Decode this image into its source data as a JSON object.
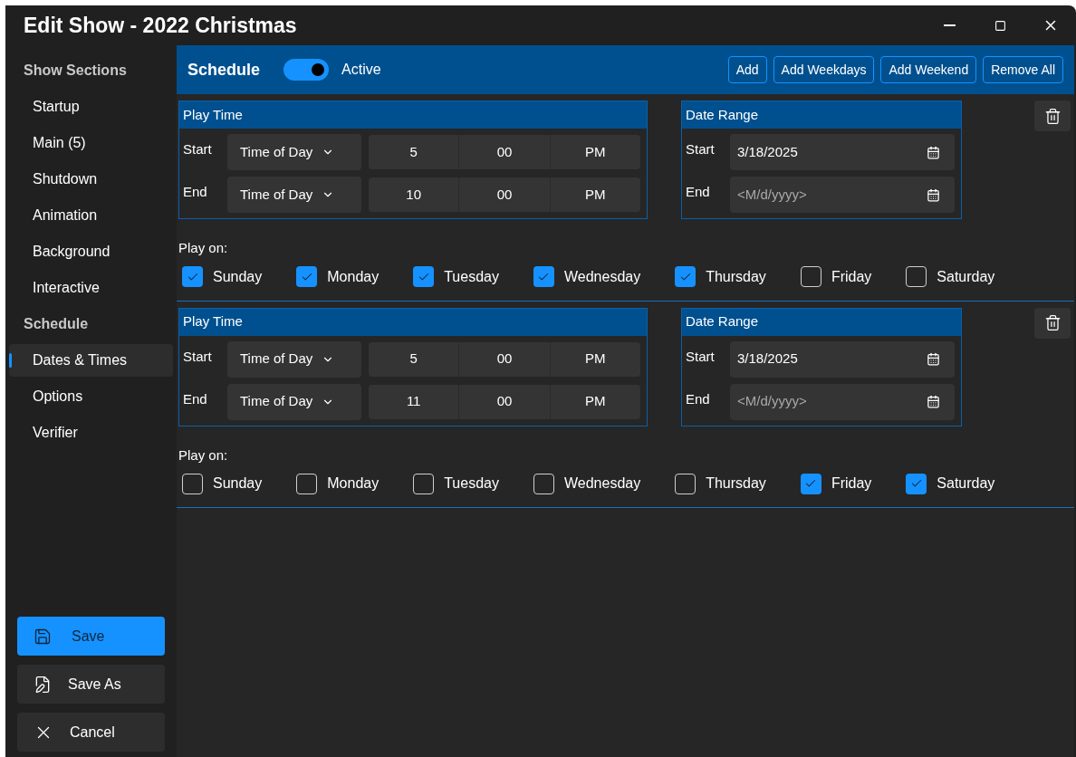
{
  "window": {
    "title": "Edit Show - 2022 Christmas"
  },
  "sidebar": {
    "groups": [
      {
        "heading": "Show Sections",
        "items": [
          {
            "label": "Startup",
            "selected": false
          },
          {
            "label": "Main (5)",
            "selected": false
          },
          {
            "label": "Shutdown",
            "selected": false
          },
          {
            "label": "Animation",
            "selected": false
          },
          {
            "label": "Background",
            "selected": false
          },
          {
            "label": "Interactive",
            "selected": false
          }
        ]
      },
      {
        "heading": "Schedule",
        "items": [
          {
            "label": "Dates & Times",
            "selected": true
          },
          {
            "label": "Options",
            "selected": false
          },
          {
            "label": "Verifier",
            "selected": false
          }
        ]
      }
    ],
    "buttons": [
      {
        "label": "Save",
        "kind": "save",
        "primary": true
      },
      {
        "label": "Save As",
        "kind": "save-as",
        "primary": false
      },
      {
        "label": "Cancel",
        "kind": "cancel",
        "primary": false
      }
    ]
  },
  "header": {
    "title": "Schedule",
    "active": {
      "label": "Active",
      "on": true
    },
    "buttons": [
      "Add",
      "Add Weekdays",
      "Add Weekend",
      "Remove All"
    ]
  },
  "schedules": [
    {
      "play_time": {
        "title": "Play Time",
        "rows": [
          {
            "label": "Start",
            "mode": "Time of Day",
            "hour": "5",
            "minute": "00",
            "period": "PM"
          },
          {
            "label": "End",
            "mode": "Time of Day",
            "hour": "10",
            "minute": "00",
            "period": "PM"
          }
        ]
      },
      "date_range": {
        "title": "Date Range",
        "rows": [
          {
            "label": "Start",
            "value": "3/18/2025"
          },
          {
            "label": "End",
            "placeholder": "<M/d/yyyy>"
          }
        ]
      },
      "play_on": {
        "label": "Play on:",
        "days": [
          {
            "label": "Sunday",
            "checked": true
          },
          {
            "label": "Monday",
            "checked": true
          },
          {
            "label": "Tuesday",
            "checked": true
          },
          {
            "label": "Wednesday",
            "checked": true
          },
          {
            "label": "Thursday",
            "checked": true
          },
          {
            "label": "Friday",
            "checked": false
          },
          {
            "label": "Saturday",
            "checked": false
          }
        ]
      }
    },
    {
      "play_time": {
        "title": "Play Time",
        "rows": [
          {
            "label": "Start",
            "mode": "Time of Day",
            "hour": "5",
            "minute": "00",
            "period": "PM"
          },
          {
            "label": "End",
            "mode": "Time of Day",
            "hour": "11",
            "minute": "00",
            "period": "PM"
          }
        ]
      },
      "date_range": {
        "title": "Date Range",
        "rows": [
          {
            "label": "Start",
            "value": "3/18/2025"
          },
          {
            "label": "End",
            "placeholder": "<M/d/yyyy>"
          }
        ]
      },
      "play_on": {
        "label": "Play on:",
        "days": [
          {
            "label": "Sunday",
            "checked": false
          },
          {
            "label": "Monday",
            "checked": false
          },
          {
            "label": "Tuesday",
            "checked": false
          },
          {
            "label": "Wednesday",
            "checked": false
          },
          {
            "label": "Thursday",
            "checked": false
          },
          {
            "label": "Friday",
            "checked": true
          },
          {
            "label": "Saturday",
            "checked": true
          }
        ]
      }
    }
  ]
}
